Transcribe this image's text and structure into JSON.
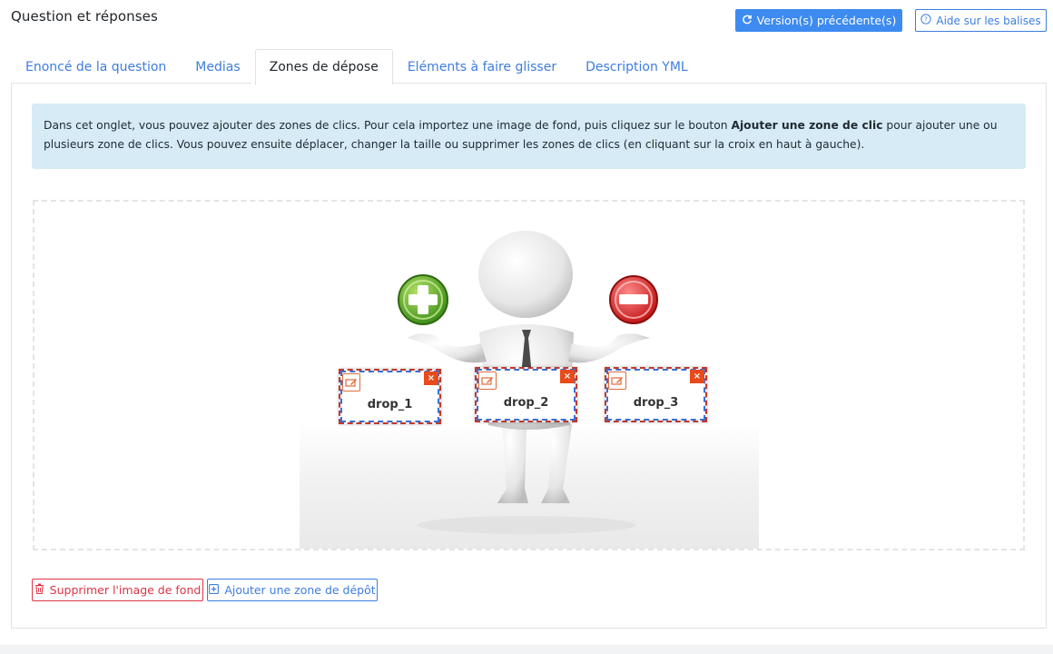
{
  "header": {
    "title": "Question et réponses",
    "prev_versions_label": "Version(s) précédente(s)",
    "help_label": "Aide sur les balises"
  },
  "tabs": [
    {
      "label": "Enoncé de la question",
      "active": false
    },
    {
      "label": "Medias",
      "active": false
    },
    {
      "label": "Zones de dépose",
      "active": true
    },
    {
      "label": "Eléments à faire glisser",
      "active": false
    },
    {
      "label": "Description YML",
      "active": false
    }
  ],
  "info": {
    "text_before": "Dans cet onglet, vous pouvez ajouter des zones de clics. Pour cela importez une image de fond, puis cliquez sur le bouton ",
    "bold": "Ajouter une zone de clic",
    "text_after": " pour ajouter une ou plusieurs zone de clics. Vous pouvez ensuite déplacer, changer la taille ou supprimer les zones de clics (en cliquant sur la croix en haut à gauche)."
  },
  "drop_zones": [
    {
      "label": "drop_1"
    },
    {
      "label": "drop_2"
    },
    {
      "label": "drop_3"
    }
  ],
  "close_glyph": "×",
  "actions": {
    "delete_bg_label": "Supprimer l'image de fond",
    "add_zone_label": "Ajouter une zone de dépôt"
  },
  "colors": {
    "primary": "#3d8bf0",
    "link": "#3d7de0",
    "danger": "#dc3545",
    "info_bg": "#d6ebf5",
    "close_red": "#e84a1a"
  }
}
